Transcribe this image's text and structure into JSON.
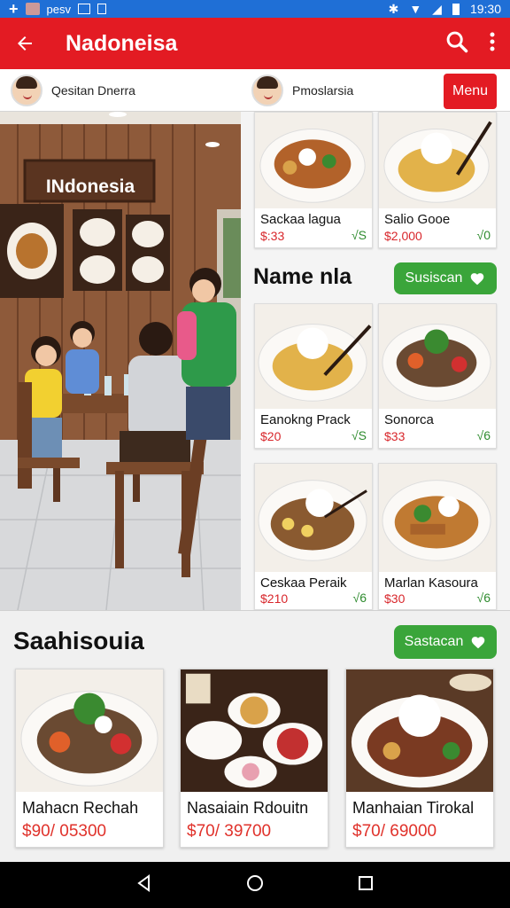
{
  "status_bar": {
    "carrier": "pesv",
    "time": "19:30"
  },
  "app_bar": {
    "title": "Nadoneisa"
  },
  "profiles": [
    {
      "name": "Qesitan Dnerra"
    },
    {
      "name": "Pmoslarsia"
    }
  ],
  "menu_button": {
    "label": "Menu"
  },
  "scene": {
    "sign_text": "INdonesia"
  },
  "top_cards": [
    {
      "name": "Sackaa lagua",
      "price": "$:33",
      "check": "√S"
    },
    {
      "name": "Salio Gooe",
      "price": "$2,000",
      "check": "√0"
    }
  ],
  "middle_section": {
    "title": "Name nla",
    "button_label": "Susiscan",
    "cards": [
      {
        "name": "Eanokng Prack",
        "price": "$20",
        "check": "√S"
      },
      {
        "name": "Sonorca",
        "price": "$33",
        "check": "√6"
      },
      {
        "name": "Ceskaa Peraik",
        "price": "$210",
        "check": "√6"
      },
      {
        "name": "Marlan Kasoura",
        "price": "$30",
        "check": "√6"
      }
    ]
  },
  "bottom_section": {
    "title": "Saahisouia",
    "button_label": "Sastacan",
    "cards": [
      {
        "name": "Mahacn Rechah",
        "price": "$90/ 05300"
      },
      {
        "name": "Nasaiain Rdouitn",
        "price": "$70/ 39700"
      },
      {
        "name": "Manhaian Tirokal",
        "price": "$70/ 69000"
      }
    ]
  },
  "colors": {
    "primary_red": "#e31b23",
    "green": "#3aa53a",
    "status_blue": "#1f6fd6"
  }
}
